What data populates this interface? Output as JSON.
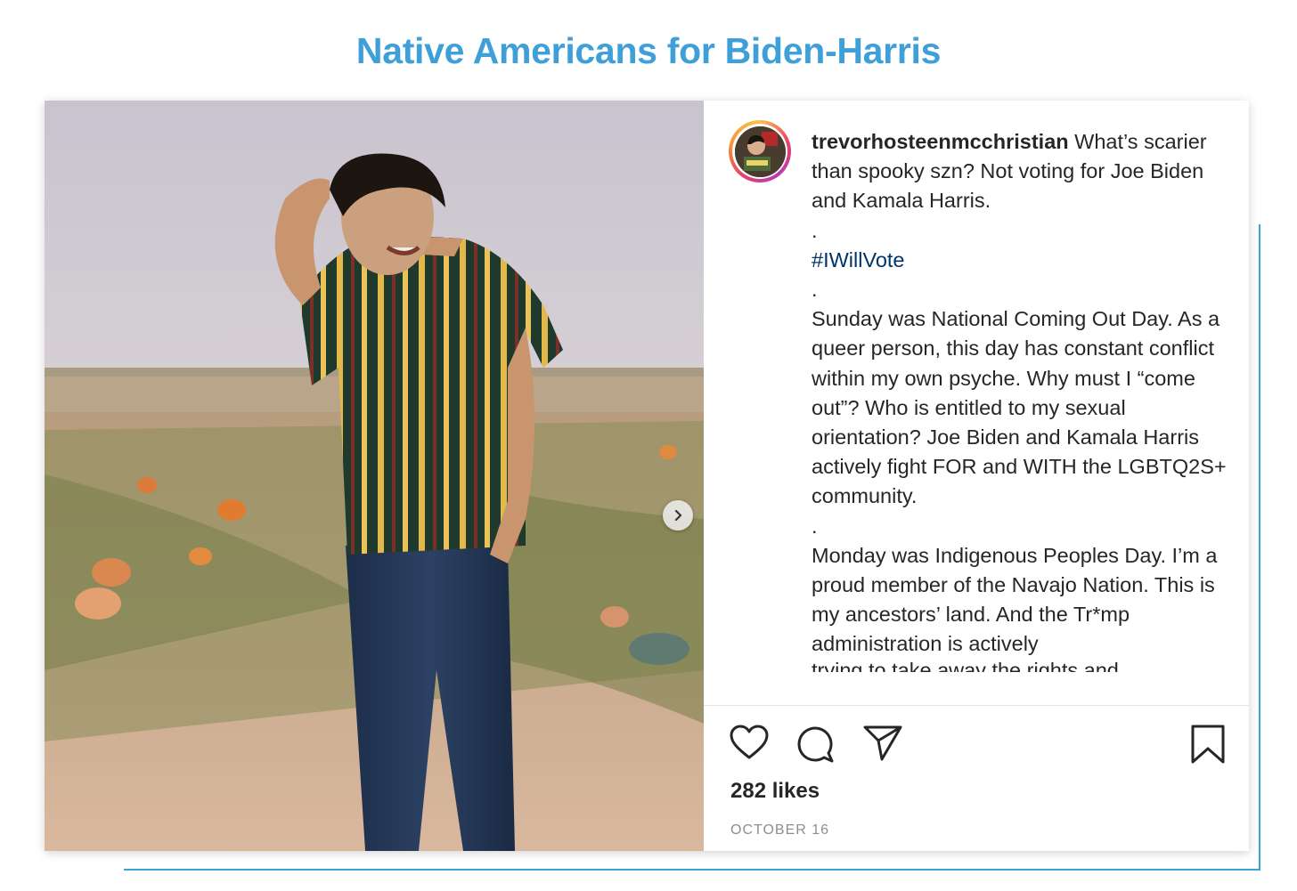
{
  "page": {
    "headline": "Native Americans for Biden-Harris",
    "accent_color": "#3f9fd8"
  },
  "post": {
    "username": "trevorhosteenmcchristian",
    "caption_lines": [
      "What’s scarier than spooky szn? Not voting for Joe Biden and Kamala Harris.",
      ".",
      "#IWillVote",
      ".",
      "Sunday was National Coming Out Day. As a queer person, this day has constant conflict within my own psyche. Why must I “come out”? Who is entitled to my sexual orientation? Joe Biden and Kamala Harris actively fight FOR and WITH the LGBTQ2S+ community.",
      ".",
      "Monday was Indigenous Peoples Day. I’m a proud member of the Navajo Nation. This is my ancestors’ land. And the Tr*mp administration is actively",
      "trying to take away the rights and"
    ],
    "likes": "282 likes",
    "date": "OCTOBER 16",
    "hashtag_color": "#003569",
    "icons": [
      "heart-icon",
      "comment-icon",
      "share-icon",
      "bookmark-icon",
      "chevron-right-icon"
    ]
  }
}
